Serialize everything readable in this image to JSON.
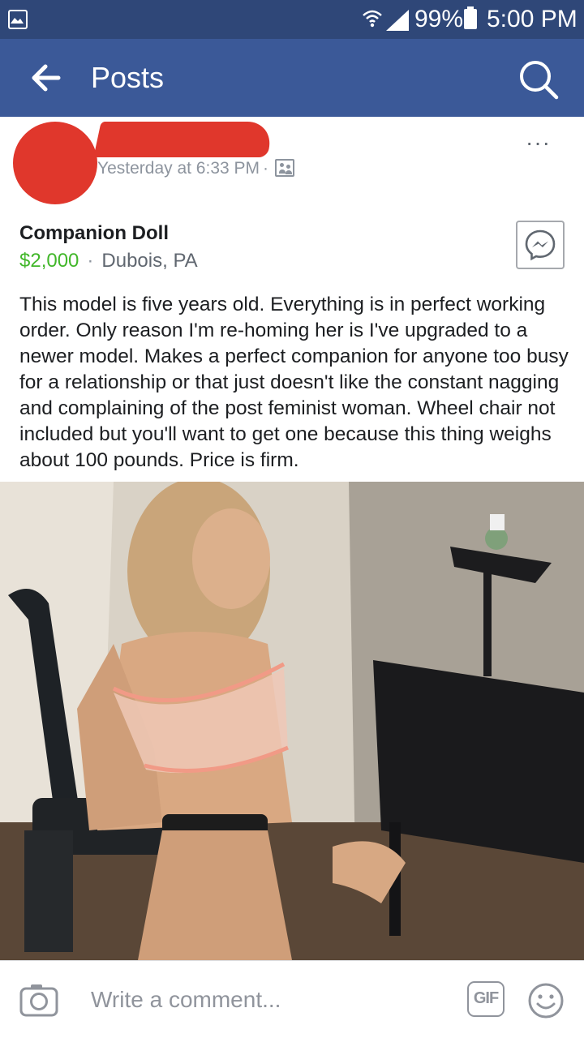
{
  "status_bar": {
    "battery_text": "99%",
    "time": "5:00 PM"
  },
  "app_bar": {
    "title": "Posts"
  },
  "post": {
    "timestamp": "Yesterday at 6:33 PM",
    "separator": "·",
    "more_label": "···"
  },
  "listing": {
    "title": "Companion Doll",
    "price": "$2,000",
    "separator": "·",
    "location": "Dubois, PA",
    "description": "This model is five years old. Everything is in perfect working order. Only reason I'm re-homing her is I've upgraded to a newer model. Makes a perfect companion for anyone too busy for a relationship or that just doesn't like the constant nagging and complaining of the post feminist woman. Wheel chair not included but you'll want to get one because this thing weighs about 100 pounds. Price is firm."
  },
  "comment_bar": {
    "placeholder": "Write a comment...",
    "gif_label": "GIF"
  },
  "colors": {
    "status_bar": "#2f4778",
    "app_bar": "#3b5998",
    "price": "#42b72a",
    "redaction": "#e0372c"
  }
}
